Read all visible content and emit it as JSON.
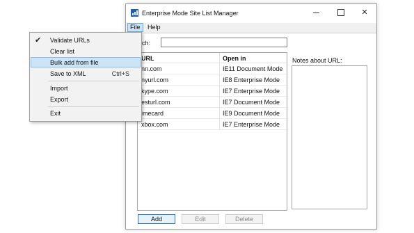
{
  "window": {
    "title": "Enterprise Mode Site List Manager",
    "controls": {
      "minimize_icon": "minimize-icon",
      "maximize_icon": "maximize-icon",
      "close_glyph": "✕"
    }
  },
  "menubar": {
    "file_label": "File",
    "help_label": "Help"
  },
  "search": {
    "label": "arch:",
    "value": ""
  },
  "list": {
    "headers": {
      "url": "URL",
      "open_in": "Open in"
    },
    "rows": [
      {
        "url": "nn.com",
        "open_in": "IE11 Document Mode"
      },
      {
        "url": "nyurl.com",
        "open_in": "IE8 Enterprise Mode"
      },
      {
        "url": "kype.com",
        "open_in": "IE7 Enterprise Mode"
      },
      {
        "url": "esturl.com",
        "open_in": "IE7 Document Mode"
      },
      {
        "url": "imecard",
        "open_in": "IE9 Document Mode"
      },
      {
        "url": "xbox.com",
        "open_in": "IE7 Enterprise Mode"
      }
    ]
  },
  "notes": {
    "label": "Notes about URL:"
  },
  "buttons": {
    "add": "Add",
    "edit": "Edit",
    "delete": "Delete"
  },
  "file_menu": {
    "items": [
      {
        "label": "Validate URLs",
        "checked": true
      },
      {
        "label": "Clear list"
      },
      {
        "label": "Bulk add from file",
        "highlighted": true
      },
      {
        "label": "Save to XML",
        "shortcut": "Ctrl+S"
      },
      {
        "label": "Import"
      },
      {
        "label": "Export"
      },
      {
        "label": "Exit"
      }
    ],
    "check_glyph": "✔"
  },
  "colors": {
    "accent": "#1b5fae",
    "highlight": "#cce4f7"
  }
}
